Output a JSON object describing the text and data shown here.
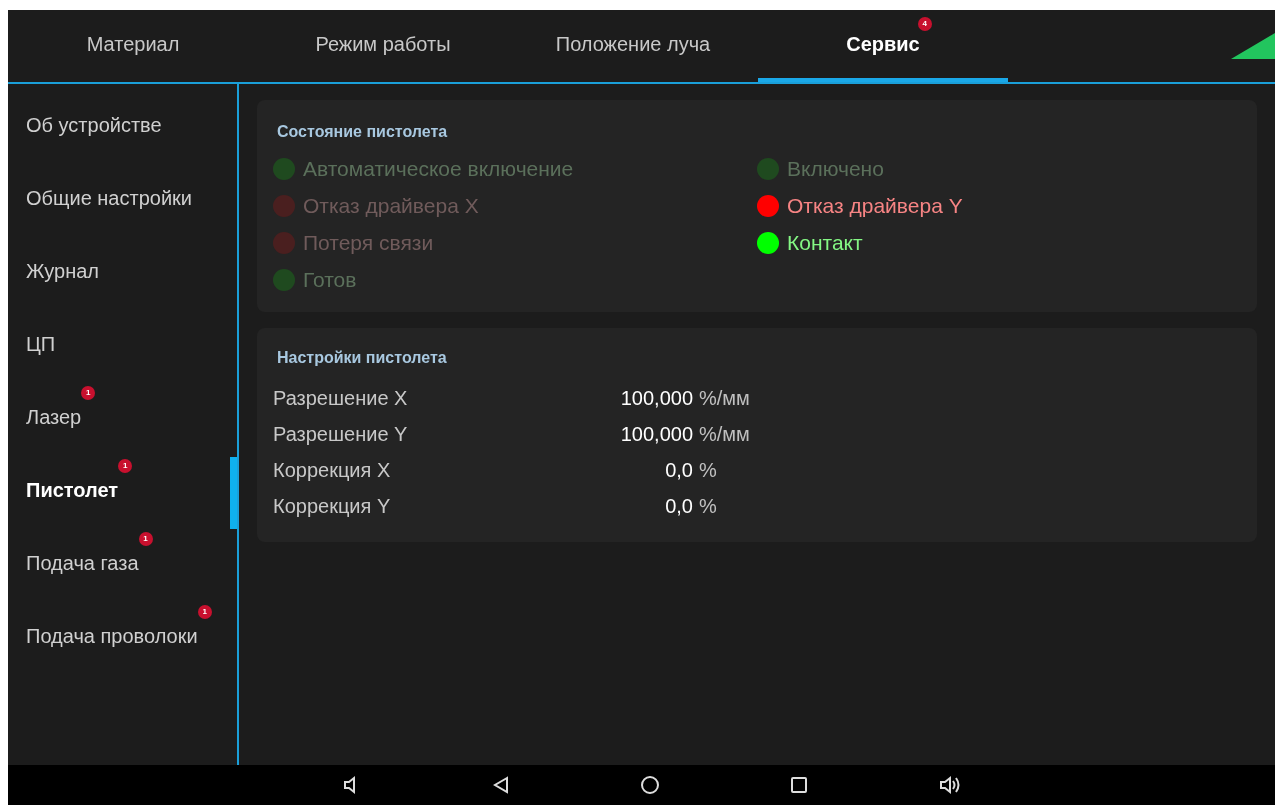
{
  "tabs": [
    {
      "label": "Материал",
      "selected": false
    },
    {
      "label": "Режим работы",
      "selected": false
    },
    {
      "label": "Положение луча",
      "selected": false
    },
    {
      "label": "Сервис",
      "selected": true,
      "badge": "4"
    }
  ],
  "sidebar": {
    "items": [
      {
        "label": "Об устройстве",
        "selected": false
      },
      {
        "label": "Общие настройки",
        "selected": false
      },
      {
        "label": "Журнал",
        "selected": false
      },
      {
        "label": "ЦП",
        "selected": false
      },
      {
        "label": "Лазер",
        "selected": false,
        "badge": "1"
      },
      {
        "label": "Пистолет",
        "selected": true,
        "badge": "1"
      },
      {
        "label": "Подача газа",
        "selected": false,
        "badge": "1"
      },
      {
        "label": "Подача проволоки",
        "selected": false,
        "badge": "1"
      }
    ]
  },
  "status_panel": {
    "title": "Состояние пистолета",
    "columns": [
      [
        {
          "label": "Автоматическое включение",
          "on": false,
          "color": "#1f4a1f"
        },
        {
          "label": "Отказ драйвера X",
          "on": false,
          "color": "#4a1f1f"
        },
        {
          "label": "Потеря связи",
          "on": false,
          "color": "#4a1f1f"
        },
        {
          "label": "Готов",
          "on": false,
          "color": "#1f4a1f"
        }
      ],
      [
        {
          "label": "Включено",
          "on": false,
          "color": "#1f4a1f"
        },
        {
          "label": "Отказ драйвера Y",
          "on": true,
          "color": "#ff0000"
        },
        {
          "label": "Контакт",
          "on": true,
          "color": "#00ff00"
        }
      ]
    ]
  },
  "settings_panel": {
    "title": "Настройки пистолета",
    "rows": [
      {
        "label": "Разрешение X",
        "value": "100,000",
        "unit": "%/мм"
      },
      {
        "label": "Разрешение Y",
        "value": "100,000",
        "unit": "%/мм"
      },
      {
        "label": "Коррекция X",
        "value": "0,0",
        "unit": "%"
      },
      {
        "label": "Коррекция Y",
        "value": "0,0",
        "unit": "%"
      }
    ]
  }
}
